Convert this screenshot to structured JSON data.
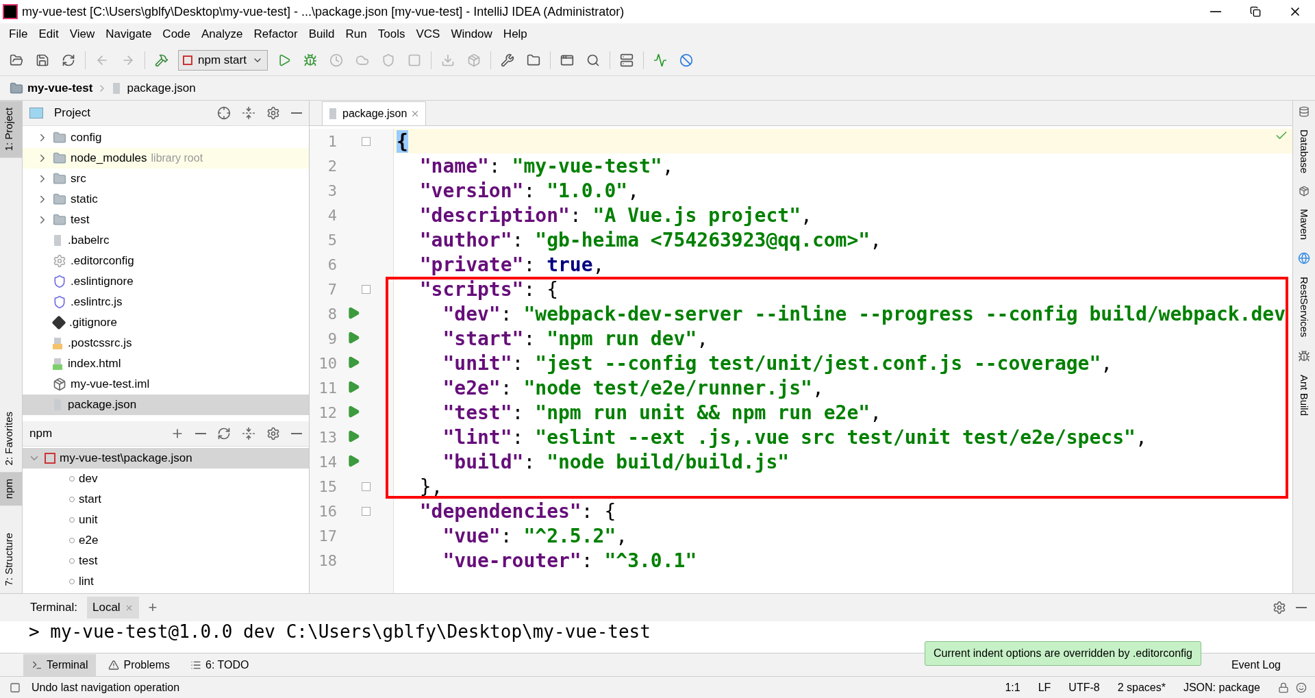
{
  "window": {
    "title": "my-vue-test [C:\\Users\\gblfy\\Desktop\\my-vue-test] - ...\\package.json [my-vue-test] - IntelliJ IDEA (Administrator)"
  },
  "menu": [
    "File",
    "Edit",
    "View",
    "Navigate",
    "Code",
    "Analyze",
    "Refactor",
    "Build",
    "Run",
    "Tools",
    "VCS",
    "Window",
    "Help"
  ],
  "toolbar": {
    "buttons": [
      {
        "disabled": false
      },
      {
        "disabled": false
      },
      {
        "disabled": false
      },
      {
        "disabled": true
      },
      {
        "disabled": true
      },
      {
        "disabled": false
      }
    ],
    "run_config": "npm start",
    "run_buttons": [
      {
        "disabled": false
      },
      {
        "disabled": false
      },
      {
        "disabled": true
      },
      {
        "disabled": true
      },
      {
        "disabled": true
      },
      {
        "disabled": true
      },
      {
        "disabled": true
      },
      {
        "disabled": true
      },
      {
        "disabled": false
      },
      {
        "disabled": false
      },
      {
        "disabled": false
      },
      {
        "disabled": false
      },
      {
        "disabled": false
      },
      {
        "disabled": false
      },
      {
        "disabled": false
      }
    ]
  },
  "breadcrumb": [
    "my-vue-test",
    "package.json"
  ],
  "left_strip": [
    {
      "label": "1: Project",
      "selected": true
    },
    {
      "label": "2: Favorites",
      "selected": false
    },
    {
      "label": "npm",
      "selected": true
    },
    {
      "label": "7: Structure",
      "selected": false
    }
  ],
  "project_panel": {
    "title": "Project",
    "items": [
      {
        "name": "config",
        "kind": "folder",
        "selected": false
      },
      {
        "name": "node_modules",
        "kind": "folder",
        "hint": "library root",
        "selected": false
      },
      {
        "name": "src",
        "kind": "folder",
        "selected": false
      },
      {
        "name": "static",
        "kind": "folder",
        "selected": false
      },
      {
        "name": "test",
        "kind": "folder",
        "selected": false
      },
      {
        "name": ".babelrc",
        "kind": "json",
        "selected": false
      },
      {
        "name": ".editorconfig",
        "kind": "config",
        "selected": false
      },
      {
        "name": ".eslintignore",
        "kind": "eslint",
        "selected": false
      },
      {
        "name": ".eslintrc.js",
        "kind": "eslint",
        "selected": false
      },
      {
        "name": ".gitignore",
        "kind": "git",
        "selected": false
      },
      {
        "name": ".postcssrc.js",
        "kind": "js",
        "selected": false
      },
      {
        "name": "index.html",
        "kind": "html",
        "selected": false
      },
      {
        "name": "my-vue-test.iml",
        "kind": "iml",
        "selected": false
      },
      {
        "name": "package.json",
        "kind": "json",
        "selected": true
      }
    ]
  },
  "npm_panel": {
    "title": "npm",
    "tree": [
      {
        "name": "my-vue-test\\package.json",
        "expanded": true,
        "selected": true,
        "children": [
          {
            "name": "dev"
          },
          {
            "name": "start"
          },
          {
            "name": "unit"
          },
          {
            "name": "e2e"
          },
          {
            "name": "test"
          },
          {
            "name": "lint"
          }
        ]
      }
    ]
  },
  "editor": {
    "tabs": [
      {
        "label": "package.json",
        "selected": true
      }
    ],
    "lines": [
      {
        "number": "1",
        "current": true,
        "fold": true,
        "run": false,
        "highlighted": false,
        "tokens": [
          {
            "kind": "brace_match",
            "text": "{"
          }
        ]
      },
      {
        "number": "2",
        "current": false,
        "fold": false,
        "run": false,
        "highlighted": false,
        "tokens": [
          {
            "kind": "key",
            "text": "  \"name\""
          },
          {
            "kind": "punct",
            "text": ": "
          },
          {
            "kind": "string",
            "text": "\"my-vue-test\""
          },
          {
            "kind": "punct",
            "text": ","
          }
        ]
      },
      {
        "number": "3",
        "current": false,
        "fold": false,
        "run": false,
        "highlighted": false,
        "tokens": [
          {
            "kind": "key",
            "text": "  \"version\""
          },
          {
            "kind": "punct",
            "text": ": "
          },
          {
            "kind": "string",
            "text": "\"1.0.0\""
          },
          {
            "kind": "punct",
            "text": ","
          }
        ]
      },
      {
        "number": "4",
        "current": false,
        "fold": false,
        "run": false,
        "highlighted": false,
        "tokens": [
          {
            "kind": "key",
            "text": "  \"description\""
          },
          {
            "kind": "punct",
            "text": ": "
          },
          {
            "kind": "string",
            "text": "\"A Vue.js project\""
          },
          {
            "kind": "punct",
            "text": ","
          }
        ]
      },
      {
        "number": "5",
        "current": false,
        "fold": false,
        "run": false,
        "highlighted": false,
        "tokens": [
          {
            "kind": "key",
            "text": "  \"author\""
          },
          {
            "kind": "punct",
            "text": ": "
          },
          {
            "kind": "string",
            "text": "\"gb-heima <754263923@qq.com>\""
          },
          {
            "kind": "punct",
            "text": ","
          }
        ]
      },
      {
        "number": "6",
        "current": false,
        "fold": false,
        "run": false,
        "highlighted": false,
        "tokens": [
          {
            "kind": "key",
            "text": "  \"private\""
          },
          {
            "kind": "punct",
            "text": ": "
          },
          {
            "kind": "keyword",
            "text": "true"
          },
          {
            "kind": "punct",
            "text": ","
          }
        ]
      },
      {
        "number": "7",
        "current": false,
        "fold": true,
        "run": false,
        "highlighted": true,
        "tokens": [
          {
            "kind": "key",
            "text": "  \"scripts\""
          },
          {
            "kind": "punct",
            "text": ": {"
          }
        ]
      },
      {
        "number": "8",
        "current": false,
        "fold": false,
        "run": true,
        "highlighted": true,
        "tokens": [
          {
            "kind": "key",
            "text": "    \"dev\""
          },
          {
            "kind": "punct",
            "text": ": "
          },
          {
            "kind": "string",
            "text": "\"webpack-dev-server --inline --progress --config build/webpack.dev"
          }
        ]
      },
      {
        "number": "9",
        "current": false,
        "fold": false,
        "run": true,
        "highlighted": true,
        "tokens": [
          {
            "kind": "key",
            "text": "    \"start\""
          },
          {
            "kind": "punct",
            "text": ": "
          },
          {
            "kind": "string",
            "text": "\"npm run dev\""
          },
          {
            "kind": "punct",
            "text": ","
          }
        ]
      },
      {
        "number": "10",
        "current": false,
        "fold": false,
        "run": true,
        "highlighted": true,
        "tokens": [
          {
            "kind": "key",
            "text": "    \"unit\""
          },
          {
            "kind": "punct",
            "text": ": "
          },
          {
            "kind": "string",
            "text": "\"jest --config test/unit/jest.conf.js --coverage\""
          },
          {
            "kind": "punct",
            "text": ","
          }
        ]
      },
      {
        "number": "11",
        "current": false,
        "fold": false,
        "run": true,
        "highlighted": true,
        "tokens": [
          {
            "kind": "key",
            "text": "    \"e2e\""
          },
          {
            "kind": "punct",
            "text": ": "
          },
          {
            "kind": "string",
            "text": "\"node test/e2e/runner.js\""
          },
          {
            "kind": "punct",
            "text": ","
          }
        ]
      },
      {
        "number": "12",
        "current": false,
        "fold": false,
        "run": true,
        "highlighted": true,
        "tokens": [
          {
            "kind": "key",
            "text": "    \"test\""
          },
          {
            "kind": "punct",
            "text": ": "
          },
          {
            "kind": "string",
            "text": "\"npm run unit && npm run e2e\""
          },
          {
            "kind": "punct",
            "text": ","
          }
        ]
      },
      {
        "number": "13",
        "current": false,
        "fold": false,
        "run": true,
        "highlighted": true,
        "tokens": [
          {
            "kind": "key",
            "text": "    \"lint\""
          },
          {
            "kind": "punct",
            "text": ": "
          },
          {
            "kind": "string",
            "text": "\"eslint --ext .js,.vue src test/unit test/e2e/specs\""
          },
          {
            "kind": "punct",
            "text": ","
          }
        ]
      },
      {
        "number": "14",
        "current": false,
        "fold": false,
        "run": true,
        "highlighted": true,
        "tokens": [
          {
            "kind": "key",
            "text": "    \"build\""
          },
          {
            "kind": "punct",
            "text": ": "
          },
          {
            "kind": "string",
            "text": "\"node build/build.js\""
          }
        ]
      },
      {
        "number": "15",
        "current": false,
        "fold": true,
        "run": false,
        "highlighted": true,
        "tokens": [
          {
            "kind": "punct",
            "text": "  },"
          }
        ]
      },
      {
        "number": "16",
        "current": false,
        "fold": true,
        "run": false,
        "highlighted": false,
        "tokens": [
          {
            "kind": "key",
            "text": "  \"dependencies\""
          },
          {
            "kind": "punct",
            "text": ": {"
          }
        ]
      },
      {
        "number": "17",
        "current": false,
        "fold": false,
        "run": false,
        "highlighted": false,
        "tokens": [
          {
            "kind": "key",
            "text": "    \"vue\""
          },
          {
            "kind": "punct",
            "text": ": "
          },
          {
            "kind": "string",
            "text": "\"^2.5.2\""
          },
          {
            "kind": "punct",
            "text": ","
          }
        ]
      },
      {
        "number": "18",
        "current": false,
        "fold": false,
        "run": false,
        "highlighted": false,
        "tokens": [
          {
            "kind": "key",
            "text": "    \"vue-router\""
          },
          {
            "kind": "punct",
            "text": ": "
          },
          {
            "kind": "string",
            "text": "\"^3.0.1\""
          }
        ]
      }
    ]
  },
  "right_strip": [
    "Database",
    "Maven",
    "RestServices",
    "Ant Build"
  ],
  "terminal": {
    "title": "Terminal:",
    "tabs": [
      {
        "label": "Local",
        "selected": true
      }
    ],
    "add": "+",
    "output": "> my-vue-test@1.0.0 dev C:\\Users\\gblfy\\Desktop\\my-vue-test"
  },
  "tool_tabs": [
    {
      "label": "Terminal",
      "selected": true
    },
    {
      "label": "Problems",
      "selected": false
    },
    {
      "label": "6: TODO",
      "selected": false
    }
  ],
  "tooltip": "Current indent options are overridden by .editorconfig",
  "event_log": "Event Log",
  "status_bar": {
    "message": "Undo last navigation operation",
    "items": [
      "1:1",
      "LF",
      "UTF-8",
      "2 spaces*",
      "JSON: package"
    ]
  }
}
